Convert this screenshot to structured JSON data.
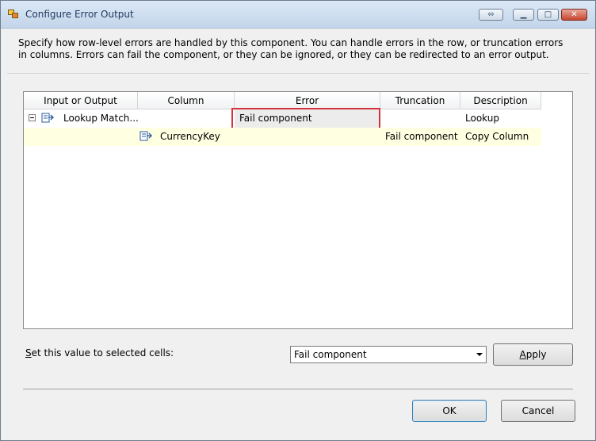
{
  "window": {
    "title": "Configure Error Output"
  },
  "title_buttons": {
    "restore_glyph": "⬄",
    "minimize_glyph": "▁",
    "maximize_glyph": "□",
    "close_glyph": "✕"
  },
  "description": "Specify how row-level errors are handled by this component. You can handle errors in the row, or truncation errors in columns. Errors can fail the component, or they can be ignored, or they can be redirected to an error output.",
  "grid": {
    "columns": [
      "Input or Output",
      "Column",
      "Error",
      "Truncation",
      "Description"
    ],
    "rows": [
      {
        "input_or_output": "Lookup Match...",
        "column": "",
        "error": "Fail component",
        "truncation": "",
        "description": "Lookup"
      },
      {
        "input_or_output": "",
        "column": "CurrencyKey",
        "error": "",
        "truncation": "Fail component",
        "description": "Copy Column"
      }
    ]
  },
  "set_value": {
    "label_prefix": "S",
    "label_rest": "et this value to selected cells:",
    "selected": "Fail component",
    "apply_prefix": "A",
    "apply_rest": "pply"
  },
  "footer": {
    "ok_label": "OK",
    "cancel_label": "Cancel"
  },
  "colors": {
    "highlight_border": "#d4333b",
    "row_highlight": "#ffffe1"
  }
}
